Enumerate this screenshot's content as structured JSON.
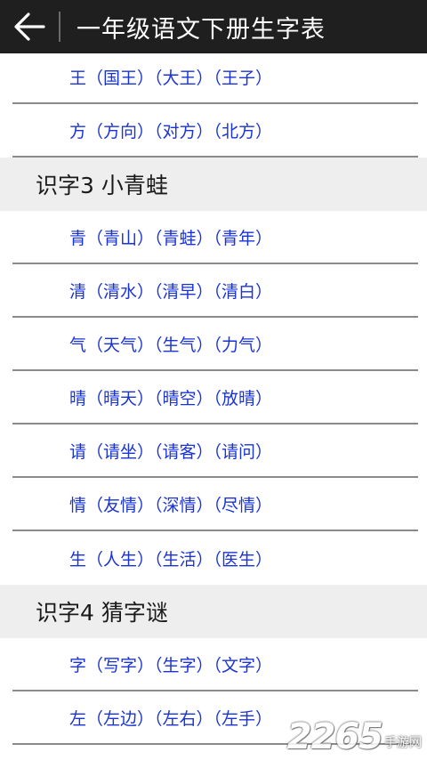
{
  "header": {
    "back_icon": "arrow-left-icon",
    "title": "一年级语文下册生字表"
  },
  "content": {
    "top_rows": [
      "王（国王）（大王）（王子）",
      "方（方向）（对方）（北方）"
    ],
    "sections": [
      {
        "title": "识字3  小青蛙",
        "rows": [
          "青（青山）（青蛙）（青年）",
          "清（清水）（清早）（清白）",
          "气（天气）（生气）（力气）",
          "晴（晴天）（晴空）（放晴）",
          "请（请坐）（请客）（请问）",
          "情（友情）（深情）（尽情）",
          "生（人生）（生活）（医生）"
        ]
      },
      {
        "title": "识字4  猜字谜",
        "rows": [
          "字（写字）（生字）（文字）",
          "左（左边）（左右）（左手）"
        ]
      }
    ]
  },
  "watermark": {
    "number": "2265",
    "text": "手游网"
  },
  "colors": {
    "topbar": "#1f1f1f",
    "link_text": "#1a33d6",
    "section_bg": "#eeeeee",
    "divider": "#8a8a8a"
  }
}
